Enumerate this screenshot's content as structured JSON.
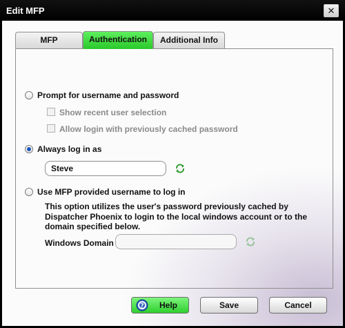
{
  "window": {
    "title": "Edit MFP",
    "close_symbol": "✕"
  },
  "tabs": [
    {
      "label": "MFP",
      "active": false
    },
    {
      "label": "Authentication",
      "active": true
    },
    {
      "label": "Additional Info",
      "active": false
    }
  ],
  "auth": {
    "prompt_option": {
      "label": "Prompt for username and password",
      "selected": false
    },
    "show_recent": {
      "label": "Show recent user selection",
      "checked": false,
      "enabled": false
    },
    "allow_cached": {
      "label": "Allow login with previously cached password",
      "checked": false,
      "enabled": false
    },
    "always_option": {
      "label": "Always log in as",
      "selected": true
    },
    "username_value": "Steve",
    "mfp_option": {
      "label": "Use MFP provided username to log in",
      "selected": false
    },
    "mfp_description": "This option utilizes the user's password previously cached by Dispatcher Phoenix to login to the local windows account or to the domain specified below.",
    "domain_label": "Windows Domain",
    "domain_value": ""
  },
  "buttons": {
    "help": "Help",
    "save": "Save",
    "cancel": "Cancel"
  },
  "icons": {
    "refresh": "refresh-icon",
    "help": "help-icon",
    "close": "close-icon"
  },
  "colors": {
    "accent_green": "#2bc82b",
    "radio_dot": "#1b56b8",
    "title_bg": "#000000"
  }
}
